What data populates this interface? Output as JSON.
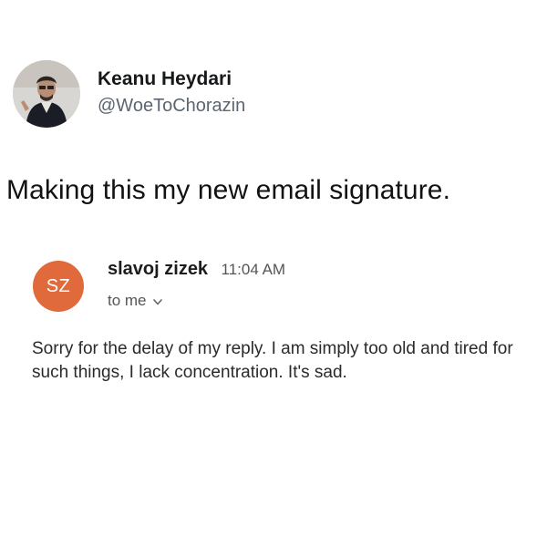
{
  "tweet": {
    "author_name": "Keanu Heydari",
    "author_handle": "@WoeToChorazin",
    "text": "Making this my new email signature."
  },
  "email": {
    "sender_initials": "SZ",
    "sender_name": "slavoj zizek",
    "time": "11:04 AM",
    "recipient": "to me",
    "body": "Sorry for the delay of my reply. I am simply too old and tired for such things, I lack concentration. It's sad."
  },
  "colors": {
    "sender_avatar_bg": "#e06a3b",
    "handle_gray": "#5b6670"
  },
  "icons": {
    "recipient_expand": "chevron-down-icon"
  }
}
